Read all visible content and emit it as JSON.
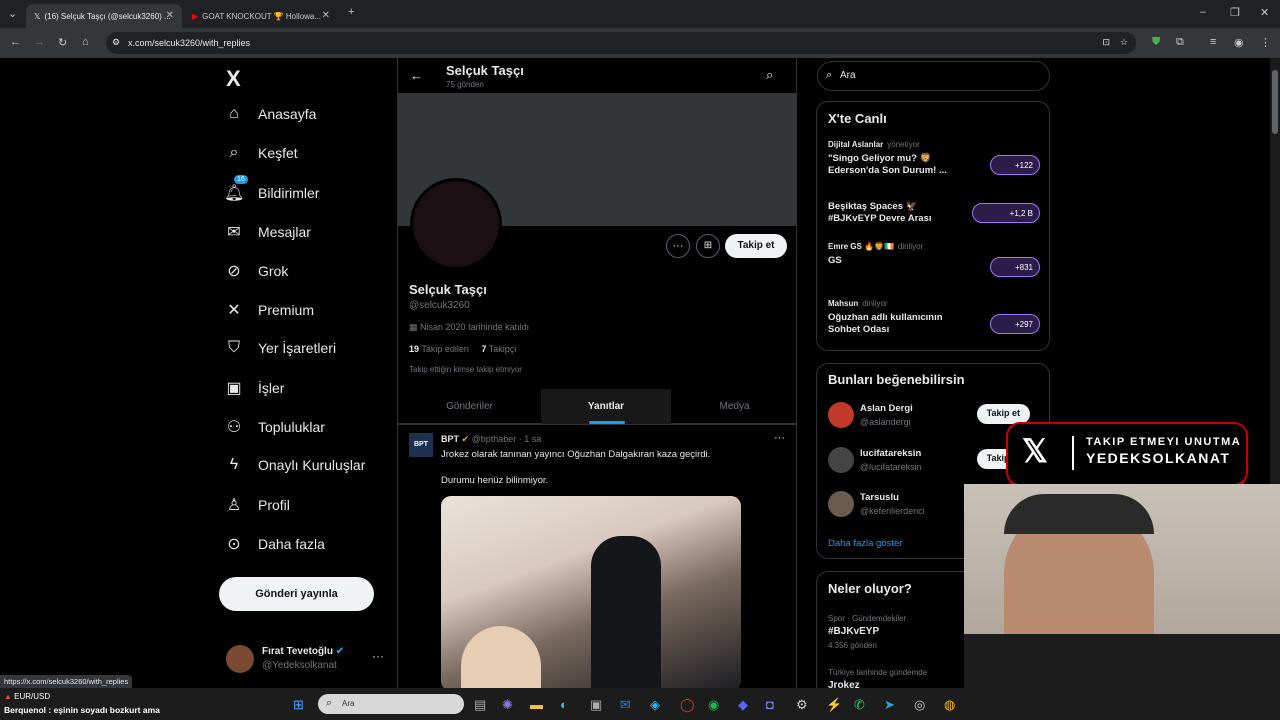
{
  "browser": {
    "tabs": [
      {
        "title": "(16) Selçuk Taşçı (@selcuk3260) ...",
        "active": true
      },
      {
        "title": "GOAT KNOCKOUT 🏆 Hollowa...",
        "active": false
      }
    ],
    "url": "x.com/selcuk3260/with_replies",
    "status_url": "https://x.com/selcuk3260/with_replies"
  },
  "nav": {
    "logo": "X",
    "items": [
      {
        "label": "Anasayfa",
        "icon": "home-icon",
        "glyph": "⌂"
      },
      {
        "label": "Keşfet",
        "icon": "search-icon",
        "glyph": "⌕"
      },
      {
        "label": "Bildirimler",
        "icon": "bell-icon",
        "glyph": "🔔︎",
        "badge": "16"
      },
      {
        "label": "Mesajlar",
        "icon": "mail-icon",
        "glyph": "✉"
      },
      {
        "label": "Grok",
        "icon": "grok-icon",
        "glyph": "⊘"
      },
      {
        "label": "Premium",
        "icon": "x-icon",
        "glyph": "✕"
      },
      {
        "label": "Yer İşaretleri",
        "icon": "bookmark-icon",
        "glyph": "⛉"
      },
      {
        "label": "İşler",
        "icon": "briefcase-icon",
        "glyph": "▣"
      },
      {
        "label": "Topluluklar",
        "icon": "communities-icon",
        "glyph": "⚇"
      },
      {
        "label": "Onaylı Kuruluşlar",
        "icon": "lightning-icon",
        "glyph": "ϟ"
      },
      {
        "label": "Profil",
        "icon": "person-icon",
        "glyph": "♙"
      },
      {
        "label": "Daha fazla",
        "icon": "more-circle-icon",
        "glyph": "⊙"
      }
    ],
    "post_button": "Gönderi yayınla",
    "account": {
      "name": "Fırat Tevetoğlu",
      "handle": "@Yedeksolkanat"
    }
  },
  "profile": {
    "header_name": "Selçuk Taşçı",
    "header_posts": "75 gönderi",
    "name": "Selçuk Taşçı",
    "handle": "@selcuk3260",
    "joined": "Nisan 2020 tarihinde katıldı",
    "following_count": "19",
    "following_label": "Takip edilen",
    "followers_count": "7",
    "followers_label": "Takipçi",
    "mutuals_note": "Takip ettiğin kimse takip etmiyor",
    "follow_button": "Takip et",
    "tabs": [
      "Gönderiler",
      "Yanıtlar",
      "Medya"
    ],
    "active_tab": "Yanıtlar"
  },
  "post": {
    "author": "BPT",
    "handle": "@bpthaber",
    "time": "1 sa",
    "text1": "Jrokez olarak tanınan yayıncı Oğuzhan Dalgakıran kaza geçirdi.",
    "text2": "Durumu henüz bilinmiyor."
  },
  "search": {
    "placeholder": "Ara"
  },
  "live": {
    "title": "X'te Canlı",
    "items": [
      {
        "host": "Dijital Aslanlar",
        "status": "yönetiyor",
        "title": "\"Singo Geliyor mu? 🦁 Ederson'da Son Durum! ...",
        "count": "+122"
      },
      {
        "host": "",
        "status": "",
        "title": "Beşiktaş Spaces 🦅 #BJKvEYP Devre Arası",
        "count": "+1,2 B"
      },
      {
        "host": "Emre GS 🔥🦁🇮🇪",
        "status": "dinliyor",
        "title": "GS",
        "count": "+831"
      },
      {
        "host": "Mahsun",
        "status": "dinliyor",
        "title": "Oğuzhan adlı kullanıcının Sohbet Odası",
        "count": "+297"
      }
    ]
  },
  "suggestions": {
    "title": "Bunları beğenebilirsin",
    "items": [
      {
        "name": "Aslan Dergi",
        "handle": "@aslandergi",
        "button": "Takip et"
      },
      {
        "name": "lucifatareksin",
        "handle": "@lucifatareksin",
        "button": "Takip et"
      },
      {
        "name": "Tarsuslu",
        "handle": "@kefenlierdenci",
        "button": ""
      }
    ],
    "more": "Daha fazla göster"
  },
  "trends": {
    "title": "Neler oluyor?",
    "items": [
      {
        "context": "Spor · Gündemdekiler",
        "name": "#BJKvEYP",
        "count": "4.356 gönderi"
      },
      {
        "context": "Türkiye tarihinde gündemde",
        "name": "Jrokez",
        "count": ""
      }
    ]
  },
  "overlay": {
    "line1": "TAKIP ETMEYI UNUTMA",
    "line2": "YEDEKSOLKANAT"
  },
  "taskbar": {
    "ticker_symbol": "EUR/USD",
    "ticker_text": "Berquenol : eşinin soyadı bozkurt ama",
    "search_placeholder": "Ara"
  },
  "colors": {
    "accent": "#1d9bf0",
    "bg": "#000000",
    "border": "#2f3336",
    "muted": "#71767b"
  }
}
